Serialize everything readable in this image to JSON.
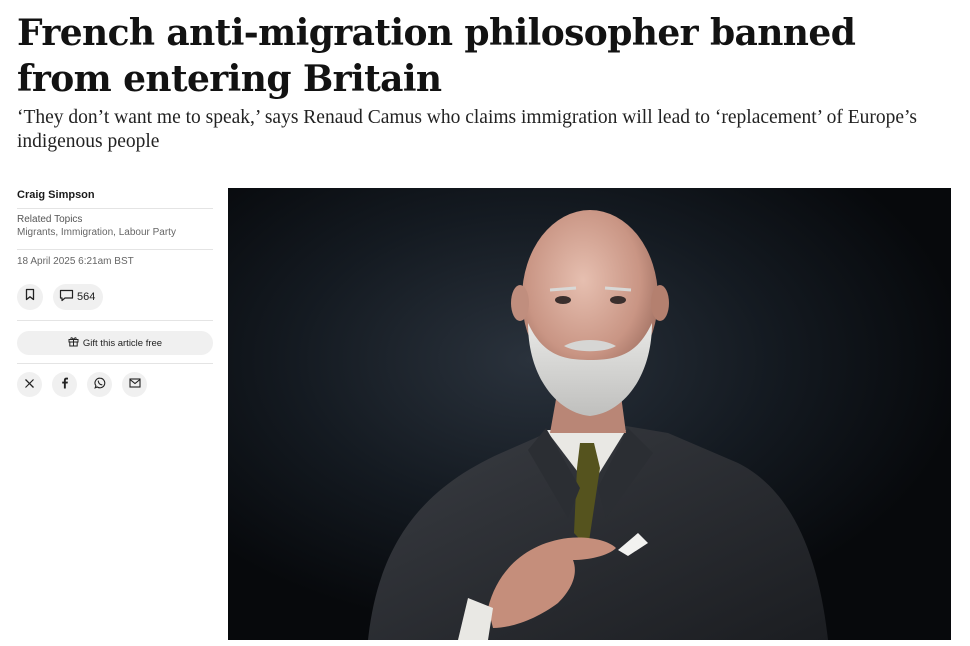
{
  "article": {
    "headline": "French anti-migration philosopher banned from entering Britain",
    "standfirst": "‘They don’t want me to speak,’ says Renaud Camus who claims immigration will lead to ‘replacement’ of Europe’s indigenous people"
  },
  "sidebar": {
    "author": "Craig Simpson",
    "topics_heading": "Related Topics",
    "topics": "Migrants, Immigration, Labour Party",
    "date": "18 April 2025 6:21am BST",
    "comment_count": "564",
    "gift_label": "Gift this article free",
    "share_icons": [
      "x-icon",
      "facebook-icon",
      "whatsapp-icon",
      "email-icon"
    ]
  },
  "hero_image": {
    "subject": "portrait-photo"
  },
  "colors": {
    "text": "#121212",
    "button_bg": "#f0f0f0",
    "photo_bg": "#0b0d10"
  }
}
